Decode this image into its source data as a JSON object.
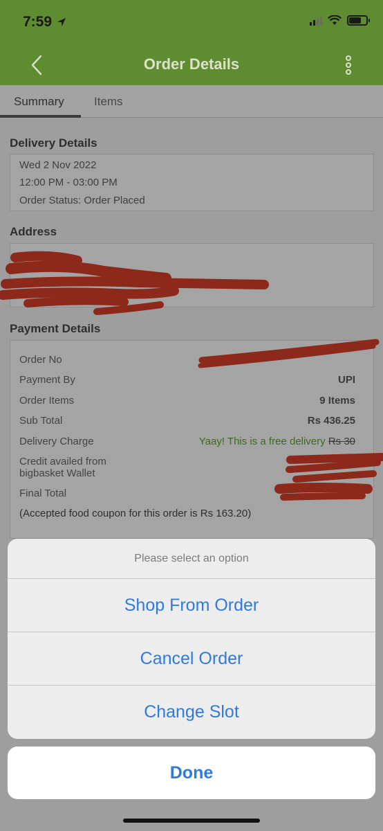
{
  "status_bar": {
    "time": "7:59"
  },
  "header": {
    "title": "Order Details"
  },
  "tabs": [
    {
      "label": "Summary",
      "active": true
    },
    {
      "label": "Items",
      "active": false
    }
  ],
  "delivery": {
    "title": "Delivery Details",
    "date": "Wed 2 Nov 2022",
    "time_slot": "12:00 PM - 03:00 PM",
    "status": "Order Status: Order Placed"
  },
  "address": {
    "title": "Address"
  },
  "payment": {
    "title": "Payment Details",
    "rows": [
      {
        "label": "Order No",
        "value": ""
      },
      {
        "label": "Payment By",
        "value": "UPI"
      },
      {
        "label": "Order Items",
        "value": "9 Items"
      },
      {
        "label": "Sub Total",
        "value": "Rs 436.25"
      },
      {
        "label": "Delivery Charge",
        "value": "Yaay! This is a free delivery",
        "value_struck": "Rs 30"
      },
      {
        "label": "Credit availed from bigbasket Wallet",
        "value": ""
      },
      {
        "label": "Final Total",
        "value": ""
      }
    ],
    "coupon_note": "(Accepted food coupon for this order is Rs 163.20)"
  },
  "action_sheet": {
    "title": "Please select an option",
    "options": [
      "Shop From Order",
      "Cancel Order",
      "Change Slot"
    ],
    "done_label": "Done"
  },
  "colors": {
    "brand_green": "#5f8c31",
    "action_blue": "#2f7ae0",
    "redaction": "#8a1f10"
  }
}
